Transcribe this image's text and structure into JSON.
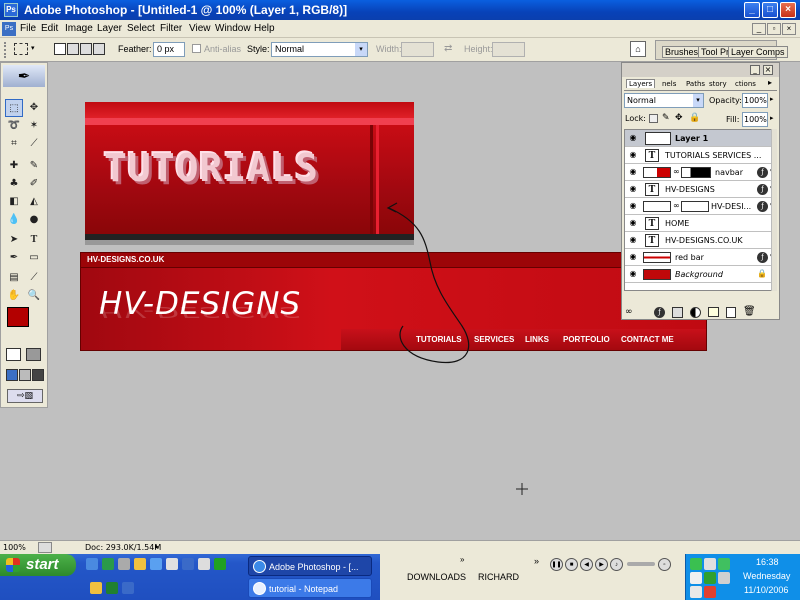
{
  "titlebar": {
    "title": "Adobe Photoshop - [Untitled-1 @ 100% (Layer 1, RGB/8)]",
    "app_icon": "Ps"
  },
  "menubar": {
    "items": [
      "File",
      "Edit",
      "Image",
      "Layer",
      "Select",
      "Filter",
      "View",
      "Window",
      "Help"
    ]
  },
  "options": {
    "feather_label": "Feather:",
    "feather_value": "0 px",
    "antialias_label": "Anti-alias",
    "style_label": "Style:",
    "style_value": "Normal",
    "width_label": "Width:",
    "height_label": "Height:",
    "tabs": [
      "Brushes",
      "Tool Pr",
      "Layer Comps"
    ]
  },
  "canvas1": {
    "heading": "TUTORIALS"
  },
  "canvas2": {
    "url": "HV-DESIGNS.CO.UK",
    "logo": "HV-DESIGNS",
    "nav": [
      "TUTORIALS",
      "SERVICES",
      "LINKS",
      "PORTFOLIO",
      "CONTACT ME"
    ]
  },
  "layers_panel": {
    "tabs": [
      "Layers",
      "nels",
      "Paths",
      "story",
      "ctions"
    ],
    "blend_mode": "Normal",
    "opacity_label": "Opacity:",
    "opacity_value": "100%",
    "lock_label": "Lock:",
    "fill_label": "Fill:",
    "fill_value": "100%",
    "layers": [
      {
        "name": "Layer 1",
        "kind": "image",
        "bold": true
      },
      {
        "name": "TUTORIALS      SERVICES ...",
        "kind": "text"
      },
      {
        "name": "navbar",
        "kind": "mask"
      },
      {
        "name": "HV-DESIGNS",
        "kind": "text"
      },
      {
        "name": "HV-DESI...",
        "kind": "mask"
      },
      {
        "name": "HOME",
        "kind": "text"
      },
      {
        "name": "HV-DESIGNS.CO.UK",
        "kind": "text"
      },
      {
        "name": "red bar",
        "kind": "image"
      },
      {
        "name": "Background",
        "kind": "background",
        "italic": true
      }
    ]
  },
  "statusbar": {
    "zoom": "100%",
    "doc": "Doc: 293.0K/1.54M"
  },
  "taskbar": {
    "start_label": "start",
    "tasks": [
      "Adobe Photoshop - [...",
      "tutorial - Notepad"
    ],
    "toolbars": [
      "DOWNLOADS",
      "RICHARD"
    ],
    "time": "16:38",
    "day": "Wednesday",
    "date": "11/10/2006"
  },
  "colors": {
    "foreground": "#b30000",
    "background": "#e00000",
    "accent_red": "#c0080a"
  }
}
